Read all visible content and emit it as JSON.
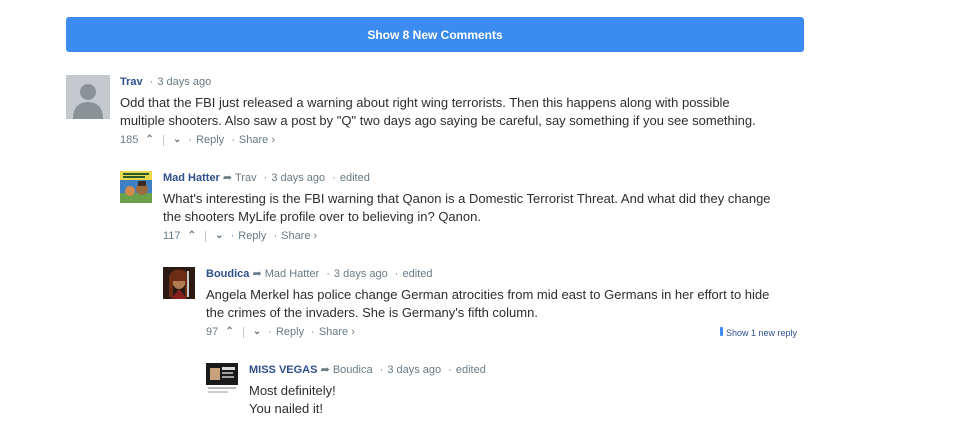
{
  "show_new_label": "Show 8 New Comments",
  "comments": [
    {
      "author": "Trav",
      "reply_to": "",
      "time": "3 days ago",
      "edited": "",
      "lines": [
        "Odd that the FBI just released a warning about right wing terrorists. Then this happens along with possible",
        "multiple shooters. Also saw a post by \"Q\" two days ago saying be careful, say something if you see something."
      ],
      "votes": "185",
      "reply_label": "Reply",
      "share_label": "Share ›"
    },
    {
      "author": "Mad Hatter",
      "reply_to": "Trav",
      "time": "3 days ago",
      "edited": "edited",
      "lines": [
        "What's interesting is the FBI warning that Qanon is a Domestic Terrorist Threat. And what did they change",
        "the shooters MyLife profile over to believing in? Qanon."
      ],
      "votes": "117",
      "reply_label": "Reply",
      "share_label": "Share ›"
    },
    {
      "author": "Boudica",
      "reply_to": "Mad Hatter",
      "time": "3 days ago",
      "edited": "edited",
      "lines": [
        "Angela Merkel has police change German atrocities from mid east to Germans in her effort to hide",
        "the crimes of the invaders. She is Germany's fifth column."
      ],
      "votes": "97",
      "reply_label": "Reply",
      "share_label": "Share ›",
      "new_reply_label": "Show 1 new reply"
    },
    {
      "author": "MISS VEGAS",
      "reply_to": "Boudica",
      "time": "3 days ago",
      "edited": "edited",
      "lines": [
        "Most definitely!",
        "You nailed it!"
      ]
    }
  ],
  "colors": {
    "accent": "#3b8bf1",
    "author": "#2e4f8c",
    "meta": "#687a86"
  },
  "icons": {
    "upvote": "chevron-up-icon",
    "downvote": "chevron-down-icon",
    "reply_arrow": "reply-arrow-icon"
  }
}
